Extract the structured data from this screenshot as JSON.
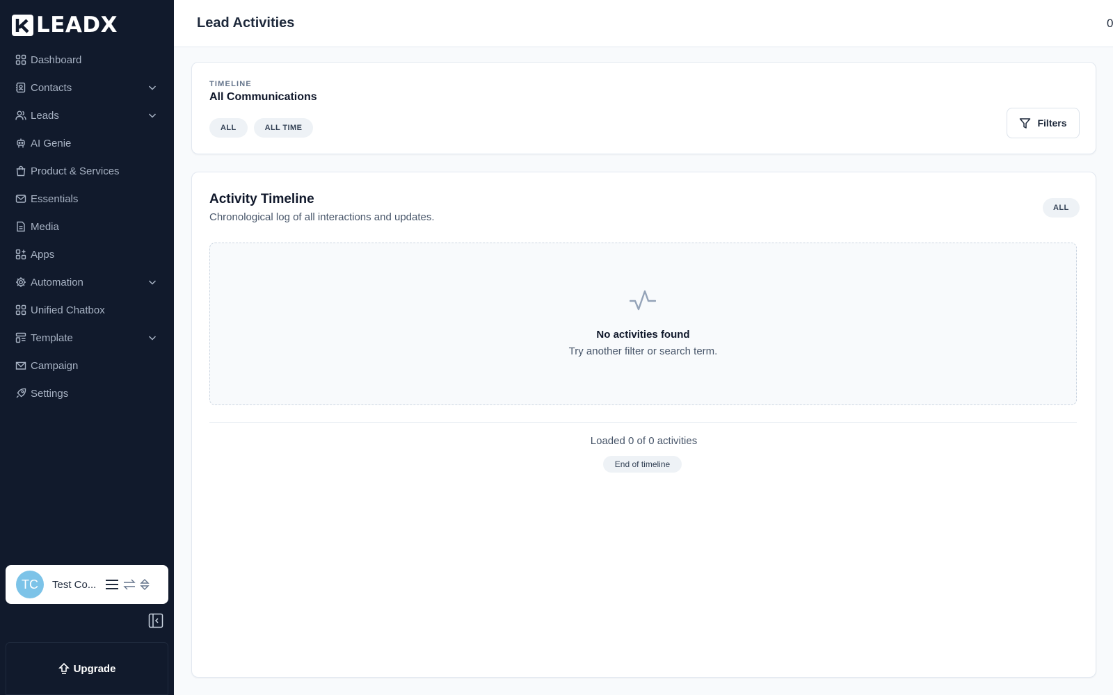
{
  "brand": {
    "name": "LEADX"
  },
  "sidebar": {
    "items": [
      {
        "label": "Dashboard",
        "icon": "grid-icon",
        "expandable": false
      },
      {
        "label": "Contacts",
        "icon": "contact-book-icon",
        "expandable": true
      },
      {
        "label": "Leads",
        "icon": "users-icon",
        "expandable": true
      },
      {
        "label": "AI Genie",
        "icon": "bot-icon",
        "expandable": false
      },
      {
        "label": "Product & Services",
        "icon": "shopping-bag-icon",
        "expandable": false
      },
      {
        "label": "Essentials",
        "icon": "mail-icon",
        "expandable": false
      },
      {
        "label": "Media",
        "icon": "file-icon",
        "expandable": false
      },
      {
        "label": "Apps",
        "icon": "apps-icon",
        "expandable": false
      },
      {
        "label": "Automation",
        "icon": "cog-icon",
        "expandable": true
      },
      {
        "label": "Unified Chatbox",
        "icon": "grid-icon",
        "expandable": false
      },
      {
        "label": "Template",
        "icon": "template-icon",
        "expandable": true
      },
      {
        "label": "Campaign",
        "icon": "envelope-open-icon",
        "expandable": false
      },
      {
        "label": "Settings",
        "icon": "rocket-icon",
        "expandable": false
      }
    ],
    "user": {
      "initials": "TC",
      "name": "Test Co..."
    },
    "upgrade_label": "Upgrade"
  },
  "header": {
    "title": "Lead Activities",
    "count": "0"
  },
  "filter_card": {
    "eyebrow": "TIMELINE",
    "title": "All Communications",
    "chips": [
      "ALL",
      "ALL TIME"
    ],
    "filters_label": "Filters"
  },
  "timeline": {
    "title": "Activity Timeline",
    "subtitle": "Chronological log of all interactions and updates.",
    "badge": "ALL",
    "empty_title": "No activities found",
    "empty_subtitle": "Try another filter or search term.",
    "loaded_text": "Loaded 0 of 0 activities",
    "end_label": "End of timeline"
  },
  "colors": {
    "sidebar_bg": "#111a2c",
    "sidebar_text": "#a7b2c3",
    "avatar_bg": "#7cc3e8",
    "chip_bg": "#eef2f6"
  }
}
